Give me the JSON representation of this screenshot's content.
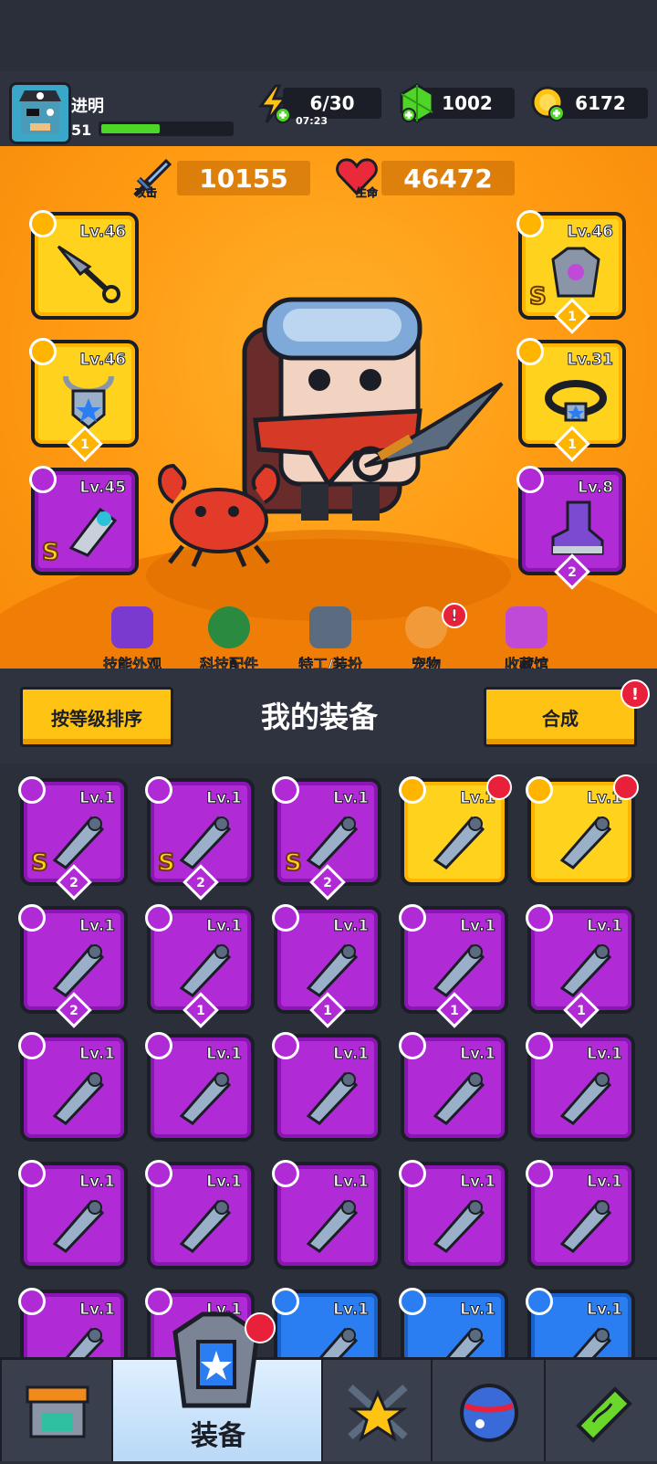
{
  "player": {
    "name": "进明",
    "level": "51",
    "xp_fraction": 0.45
  },
  "resources": {
    "energy": {
      "value": "6/30",
      "timer": "07:23",
      "color": "#ffc313"
    },
    "gems": {
      "value": "1002",
      "color": "#4dd627"
    },
    "coins": {
      "value": "6172",
      "color": "#ffc313"
    }
  },
  "stats": {
    "attack": {
      "label": "攻击",
      "value": "10155"
    },
    "hp": {
      "label": "生命",
      "value": "46472"
    }
  },
  "equipped": [
    {
      "side": "left",
      "rarity": "gold",
      "level": "Lv.46",
      "icon": "kunai-icon",
      "slot_icon": "weapon-slot-icon"
    },
    {
      "side": "left",
      "rarity": "gold",
      "level": "Lv.46",
      "icon": "necklace-shield-icon",
      "slot_icon": "necklace-slot-icon",
      "stars": "1"
    },
    {
      "side": "left",
      "rarity": "purple",
      "level": "Lv.45",
      "icon": "gauntlet-icon",
      "slot_icon": "glove-slot-icon",
      "s_mark": "S"
    },
    {
      "side": "right",
      "rarity": "gold",
      "level": "Lv.46",
      "icon": "armor-icon",
      "slot_icon": "armor-slot-icon",
      "s_mark": "S",
      "stars": "1"
    },
    {
      "side": "right",
      "rarity": "gold",
      "level": "Lv.31",
      "icon": "belt-icon",
      "slot_icon": "belt-slot-icon",
      "stars": "1"
    },
    {
      "side": "right",
      "rarity": "purple",
      "level": "Lv.8",
      "icon": "boots-icon",
      "slot_icon": "boots-slot-icon",
      "stars": "2"
    }
  ],
  "stage_menu": [
    {
      "label": "技能外观",
      "icon": "skill-skin-icon"
    },
    {
      "label": "科技配件",
      "icon": "tech-part-icon"
    },
    {
      "label": "特工/装扮",
      "icon": "agent-costume-icon"
    },
    {
      "label": "宠物",
      "icon": "pet-icon",
      "alert": "!"
    },
    {
      "label": "收藏馆",
      "icon": "collection-icon"
    }
  ],
  "inventory_bar": {
    "sort_label": "按等级排序",
    "title": "我的装备",
    "merge_label": "合成",
    "merge_alert": "!"
  },
  "inventory": [
    {
      "rarity": "purple",
      "level": "Lv.1",
      "icon": "flame-sword-icon",
      "slot_icon": "weapon-slot-icon",
      "s_mark": "S",
      "stars": "2"
    },
    {
      "rarity": "purple",
      "level": "Lv.1",
      "icon": "blaster-icon",
      "slot_icon": "weapon-slot-icon",
      "s_mark": "S",
      "stars": "2"
    },
    {
      "rarity": "purple",
      "level": "Lv.1",
      "icon": "mech-armor-icon",
      "slot_icon": "armor-slot-icon",
      "s_mark": "S",
      "stars": "2"
    },
    {
      "rarity": "gold",
      "level": "Lv.1",
      "icon": "mech-glove-icon",
      "slot_icon": "glove-slot-icon",
      "badge": true
    },
    {
      "rarity": "gold",
      "level": "Lv.1",
      "icon": "steel-glove-icon",
      "slot_icon": "glove-slot-icon",
      "badge": true
    },
    {
      "rarity": "purple",
      "level": "Lv.1",
      "icon": "plant-boot-icon",
      "slot_icon": "boots-slot-icon",
      "stars": "2"
    },
    {
      "rarity": "purple",
      "level": "Lv.1",
      "icon": "shotgun-icon",
      "slot_icon": "weapon-slot-icon",
      "stars": "1"
    },
    {
      "rarity": "purple",
      "level": "Lv.1",
      "icon": "vest-icon",
      "slot_icon": "armor-slot-icon",
      "stars": "1"
    },
    {
      "rarity": "purple",
      "level": "Lv.1",
      "icon": "vest-icon",
      "slot_icon": "armor-slot-icon",
      "stars": "1"
    },
    {
      "rarity": "purple",
      "level": "Lv.1",
      "icon": "sneaker-icon",
      "slot_icon": "boots-slot-icon",
      "stars": "1"
    },
    {
      "rarity": "purple",
      "level": "Lv.1",
      "icon": "kunai-icon",
      "slot_icon": "weapon-slot-icon"
    },
    {
      "rarity": "purple",
      "level": "Lv.1",
      "icon": "katana-icon",
      "slot_icon": "weapon-slot-icon"
    },
    {
      "rarity": "purple",
      "level": "Lv.1",
      "icon": "bat-icon",
      "slot_icon": "weapon-slot-icon"
    },
    {
      "rarity": "purple",
      "level": "Lv.1",
      "icon": "chest-plate-icon",
      "slot_icon": "armor-slot-icon"
    },
    {
      "rarity": "purple",
      "level": "Lv.1",
      "icon": "lantern-necklace-icon",
      "slot_icon": "necklace-slot-icon"
    },
    {
      "rarity": "purple",
      "level": "Lv.1",
      "icon": "necklace-shield-icon",
      "slot_icon": "necklace-slot-icon"
    },
    {
      "rarity": "purple",
      "level": "Lv.1",
      "icon": "necklace-shield-icon",
      "slot_icon": "necklace-slot-icon"
    },
    {
      "rarity": "purple",
      "level": "Lv.1",
      "icon": "rope-belt-icon",
      "slot_icon": "belt-slot-icon"
    },
    {
      "rarity": "purple",
      "level": "Lv.1",
      "icon": "gem-belt-icon",
      "slot_icon": "belt-slot-icon"
    },
    {
      "rarity": "purple",
      "level": "Lv.1",
      "icon": "belt-icon",
      "slot_icon": "belt-slot-icon"
    },
    {
      "rarity": "purple",
      "level": "Lv.1",
      "icon": "glove-icon",
      "slot_icon": "glove-slot-icon"
    },
    {
      "rarity": "purple",
      "level": "Lv.1",
      "icon": "boot-icon",
      "slot_icon": "boots-slot-icon"
    },
    {
      "rarity": "blue",
      "level": "Lv.1",
      "icon": "spear-icon",
      "slot_icon": "weapon-slot-icon"
    },
    {
      "rarity": "blue",
      "level": "Lv.1",
      "icon": "scimitar-icon",
      "slot_icon": "weapon-slot-icon"
    },
    {
      "rarity": "blue",
      "level": "Lv.1",
      "icon": "revolver-icon",
      "slot_icon": "weapon-slot-icon"
    }
  ],
  "bottom_nav": [
    {
      "label": "",
      "icon": "shop-icon"
    },
    {
      "label": "装备",
      "icon": "equipment-icon",
      "active": true,
      "badge": true
    },
    {
      "label": "",
      "icon": "star-swords-icon"
    },
    {
      "label": "",
      "icon": "planet-icon"
    },
    {
      "label": "",
      "icon": "dna-capsule-icon"
    }
  ]
}
